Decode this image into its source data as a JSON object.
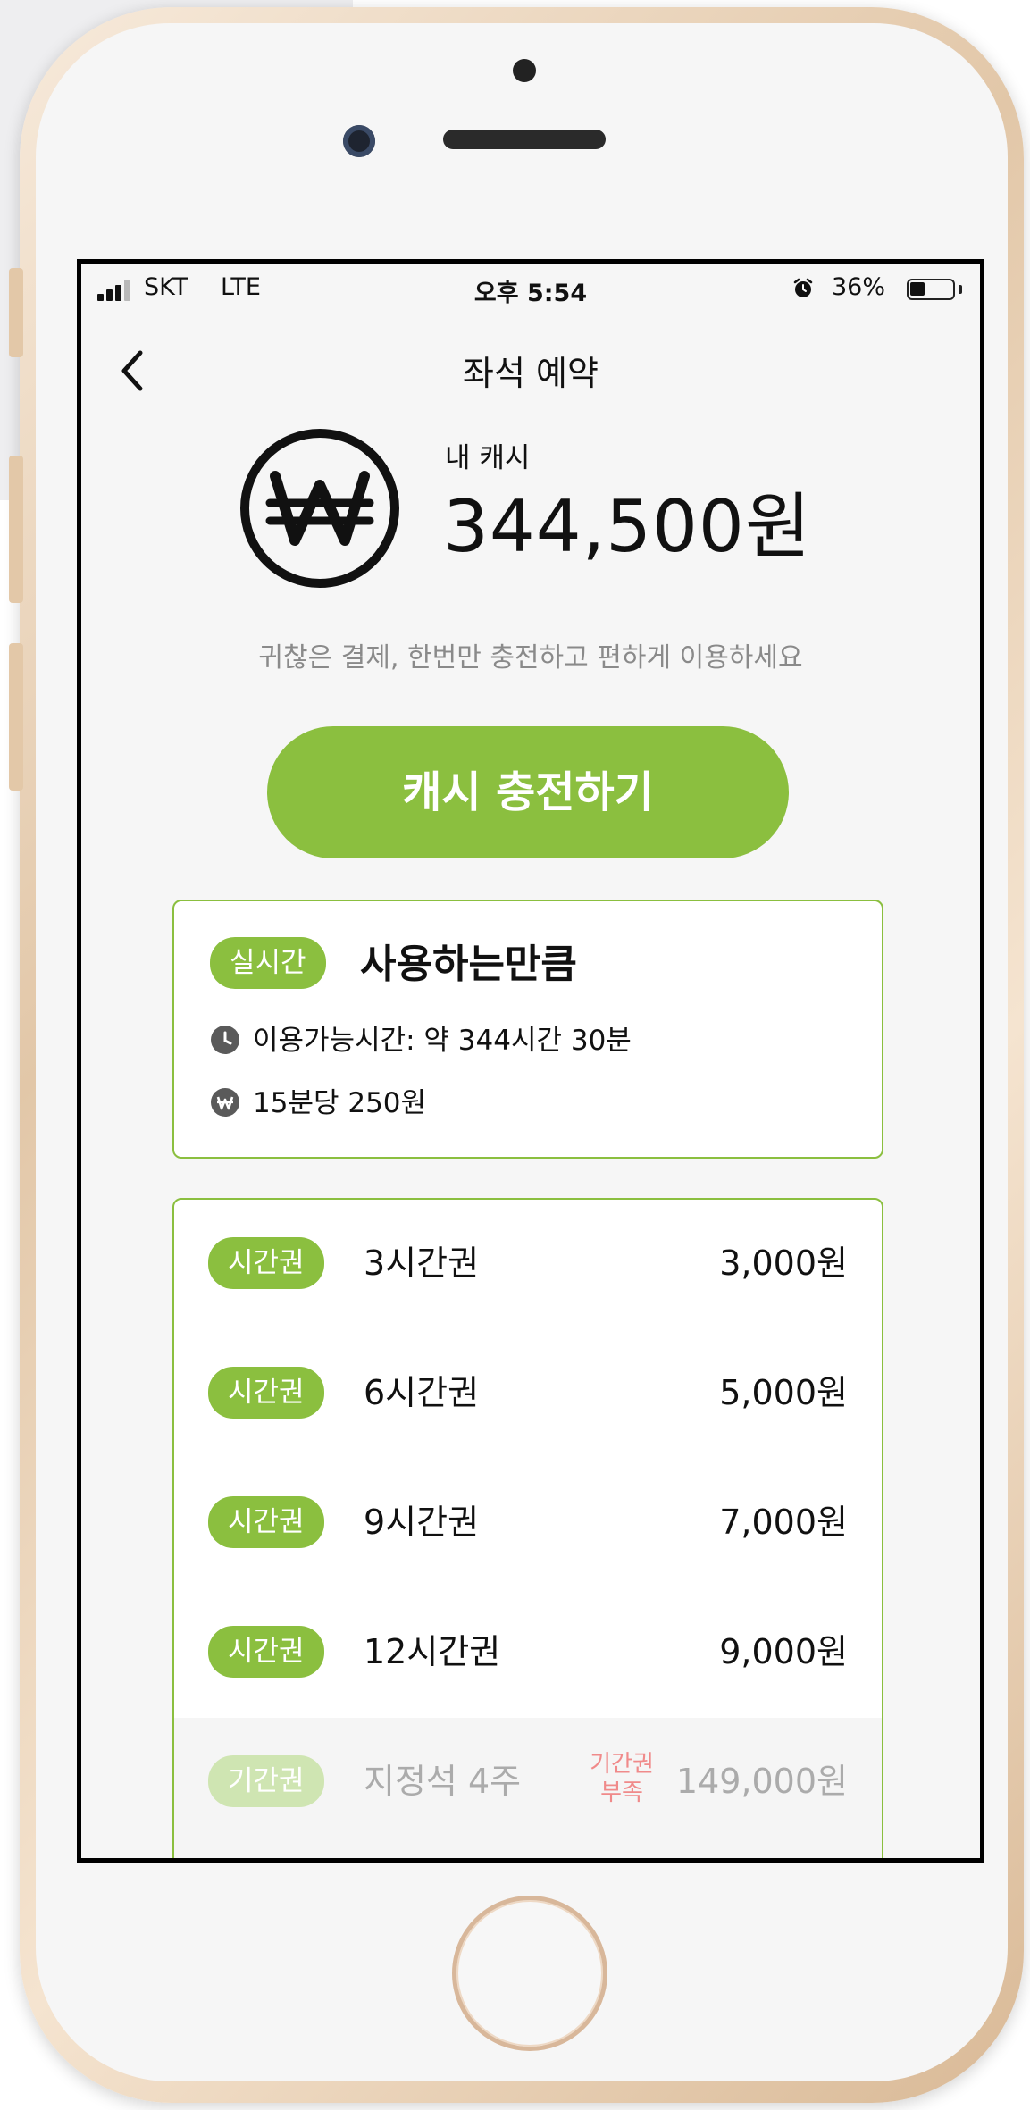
{
  "status_bar": {
    "carrier": "SKT",
    "network": "LTE",
    "time": "오후 5:54",
    "battery_percent": "36%",
    "battery_level": 0.36
  },
  "header": {
    "title": "좌석 예약"
  },
  "wallet": {
    "label": "내 캐시",
    "amount": "344,500원",
    "promo": "귀찮은 결제, 한번만 충전하고 편하게 이용하세요",
    "charge_button": "캐시 충전하기"
  },
  "realtime_plan": {
    "tag": "실시간",
    "title": "사용하는만큼",
    "available_time": "이용가능시간: 약 344시간 30분",
    "rate": "15분당 250원"
  },
  "passes": [
    {
      "tag": "시간권",
      "name": "3시간권",
      "price": "3,000원"
    },
    {
      "tag": "시간권",
      "name": "6시간권",
      "price": "5,000원"
    },
    {
      "tag": "시간권",
      "name": "9시간권",
      "price": "7,000원"
    },
    {
      "tag": "시간권",
      "name": "12시간권",
      "price": "9,000원"
    },
    {
      "tag": "기간권",
      "name": "지정석 4주",
      "price": "149,000원",
      "status_line1": "기간권",
      "status_line2": "부족"
    }
  ],
  "colors": {
    "accent": "#8bbf3f",
    "shortage": "#f08a8a"
  }
}
